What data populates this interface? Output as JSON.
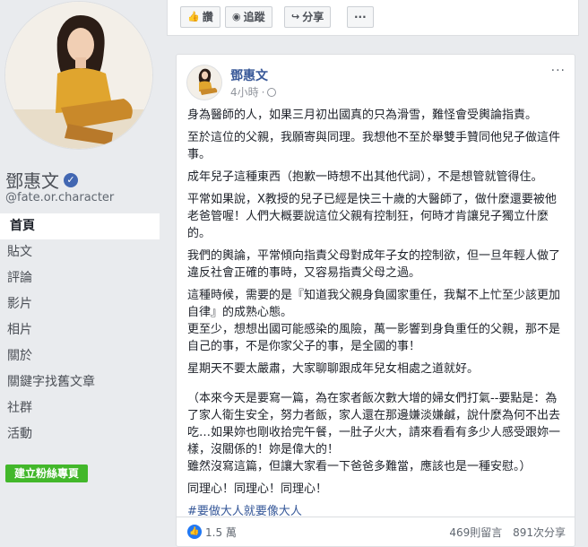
{
  "profile": {
    "name": "鄧惠文",
    "handle": "@fate.or.character",
    "verified_icon": "verified-badge-icon"
  },
  "nav": {
    "items": [
      "首頁",
      "貼文",
      "評論",
      "影片",
      "相片",
      "關於",
      "關鍵字找舊文章",
      "社群",
      "活動"
    ],
    "active": "首頁",
    "create_page_label": "建立粉絲專頁"
  },
  "topbar": {
    "like_label": "讚",
    "follow_label": "追蹤",
    "share_label": "分享",
    "more_label": "···"
  },
  "post": {
    "author": "鄧惠文",
    "time": "4小時",
    "more_label": "···",
    "paragraphs": [
      "身為醫師的人，如果三月初出國真的只為滑雪，難怪會受輿論指責。",
      "至於這位的父親，我願寄與同理。我想他不至於舉雙手贊同他兒子做這件事。",
      "成年兒子這種東西（抱歉一時想不出其他代詞），不是想管就管得住。",
      "平常如果說，X教授的兒子已經是快三十歲的大醫師了，做什麼還要被他老爸管喔！人們大概要說這位父親有控制狂，何時才肯讓兒子獨立什麼的。",
      "我們的輿論，平常傾向指責父母對成年子女的控制欲，但一旦年輕人做了違反社會正確的事時，又容易指責父母之過。",
      "這種時候，需要的是『知道我父親身負國家重任，我幫不上忙至少該更加自律』的成熟心態。",
      "更至少，想想出國可能感染的風險，萬一影響到身負重任的父親，那不是自己的事，不是你家父子的事，是全國的事！",
      "星期天不要太嚴肅，大家聊聊跟成年兒女相處之道就好。",
      "（本來今天是要寫一篇，為在家者飯次數大增的婦女們打氣--要點是：為了家人衛生安全，努力者飯，家人還在那邊嫌淡嫌鹹，說什麼為何不出去吃…如果妳也剛收拾完午餐，一肚子火大，請來看看有多少人感受跟妳一樣，沒關係的！妳是偉大的！",
      "雖然沒寫這篇，但讓大家看一下爸爸多難當，應該也是一種安慰。）",
      "同理心！同理心！同理心！"
    ],
    "hashtag": "#要做大人就要像大人",
    "reactions": "1.5 萬",
    "comments": "469則留言",
    "shares": "891次分享"
  },
  "colors": {
    "background": "#e9ebee",
    "link": "#385898",
    "create_button": "#42b72a",
    "like_blue": "#2078f4"
  }
}
